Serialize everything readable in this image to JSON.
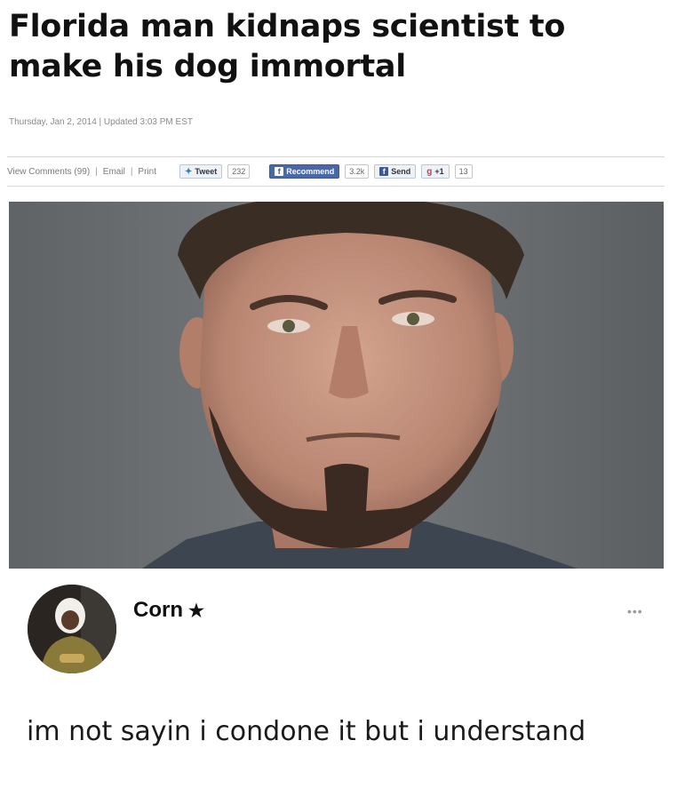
{
  "article": {
    "headline": "Florida man kidnaps scientist to make his dog immortal",
    "dateline": "Thursday, Jan 2, 2014 | Updated 3:03 PM EST",
    "share": {
      "view_comments": "View Comments (99)",
      "email": "Email",
      "print": "Print",
      "tweet_label": "Tweet",
      "tweet_count": "232",
      "recommend_label": "Recommend",
      "recommend_count": "3.2k",
      "send_label": "Send",
      "gplus_label": "+1",
      "gplus_count": "13"
    },
    "photo_icon": "mugshot-photo"
  },
  "post": {
    "author": "Corn",
    "author_badge": "★",
    "more": "•••",
    "text": "im not sayin i condone it but i understand"
  },
  "colors": {
    "facebook_blue": "#3b5998",
    "photo_background": "#6b6e71"
  }
}
